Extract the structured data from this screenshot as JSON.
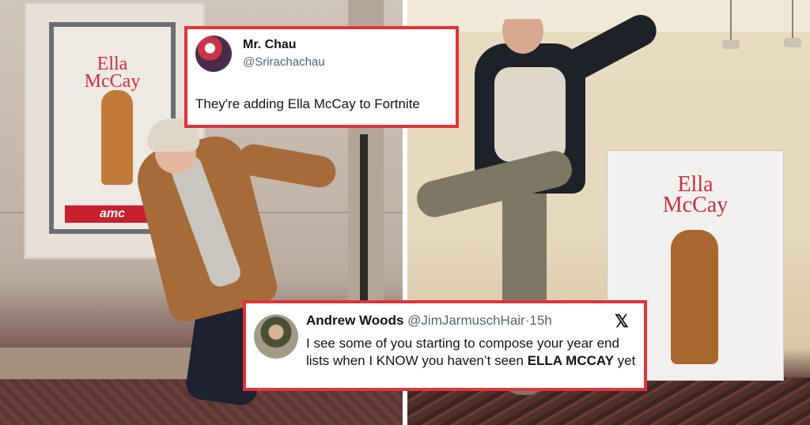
{
  "left_photo": {
    "poster_title_line1": "Ella",
    "poster_title_line2": "McCay",
    "theater_logo": "amc"
  },
  "right_photo": {
    "standee_title_line1": "Ella",
    "standee_title_line2": "McCay"
  },
  "tweet_top": {
    "name": "Mr. Chau",
    "handle": "@Srirachachau",
    "text": "They're adding Ella McCay to Fortnite"
  },
  "tweet_bottom": {
    "name": "Andrew Woods",
    "handle": "@JimJarmuschHair",
    "separator": "·",
    "time": "15h",
    "platform_icon": "x-logo",
    "text_part1": "I see some of you starting to compose your year end lists when I KNOW you haven’t seen ",
    "text_bold": "ELLA MCCAY",
    "text_part2": " yet"
  },
  "colors": {
    "card_border": "#e1333b",
    "handle_gray": "#536471",
    "poster_red": "#cf2e3e"
  }
}
